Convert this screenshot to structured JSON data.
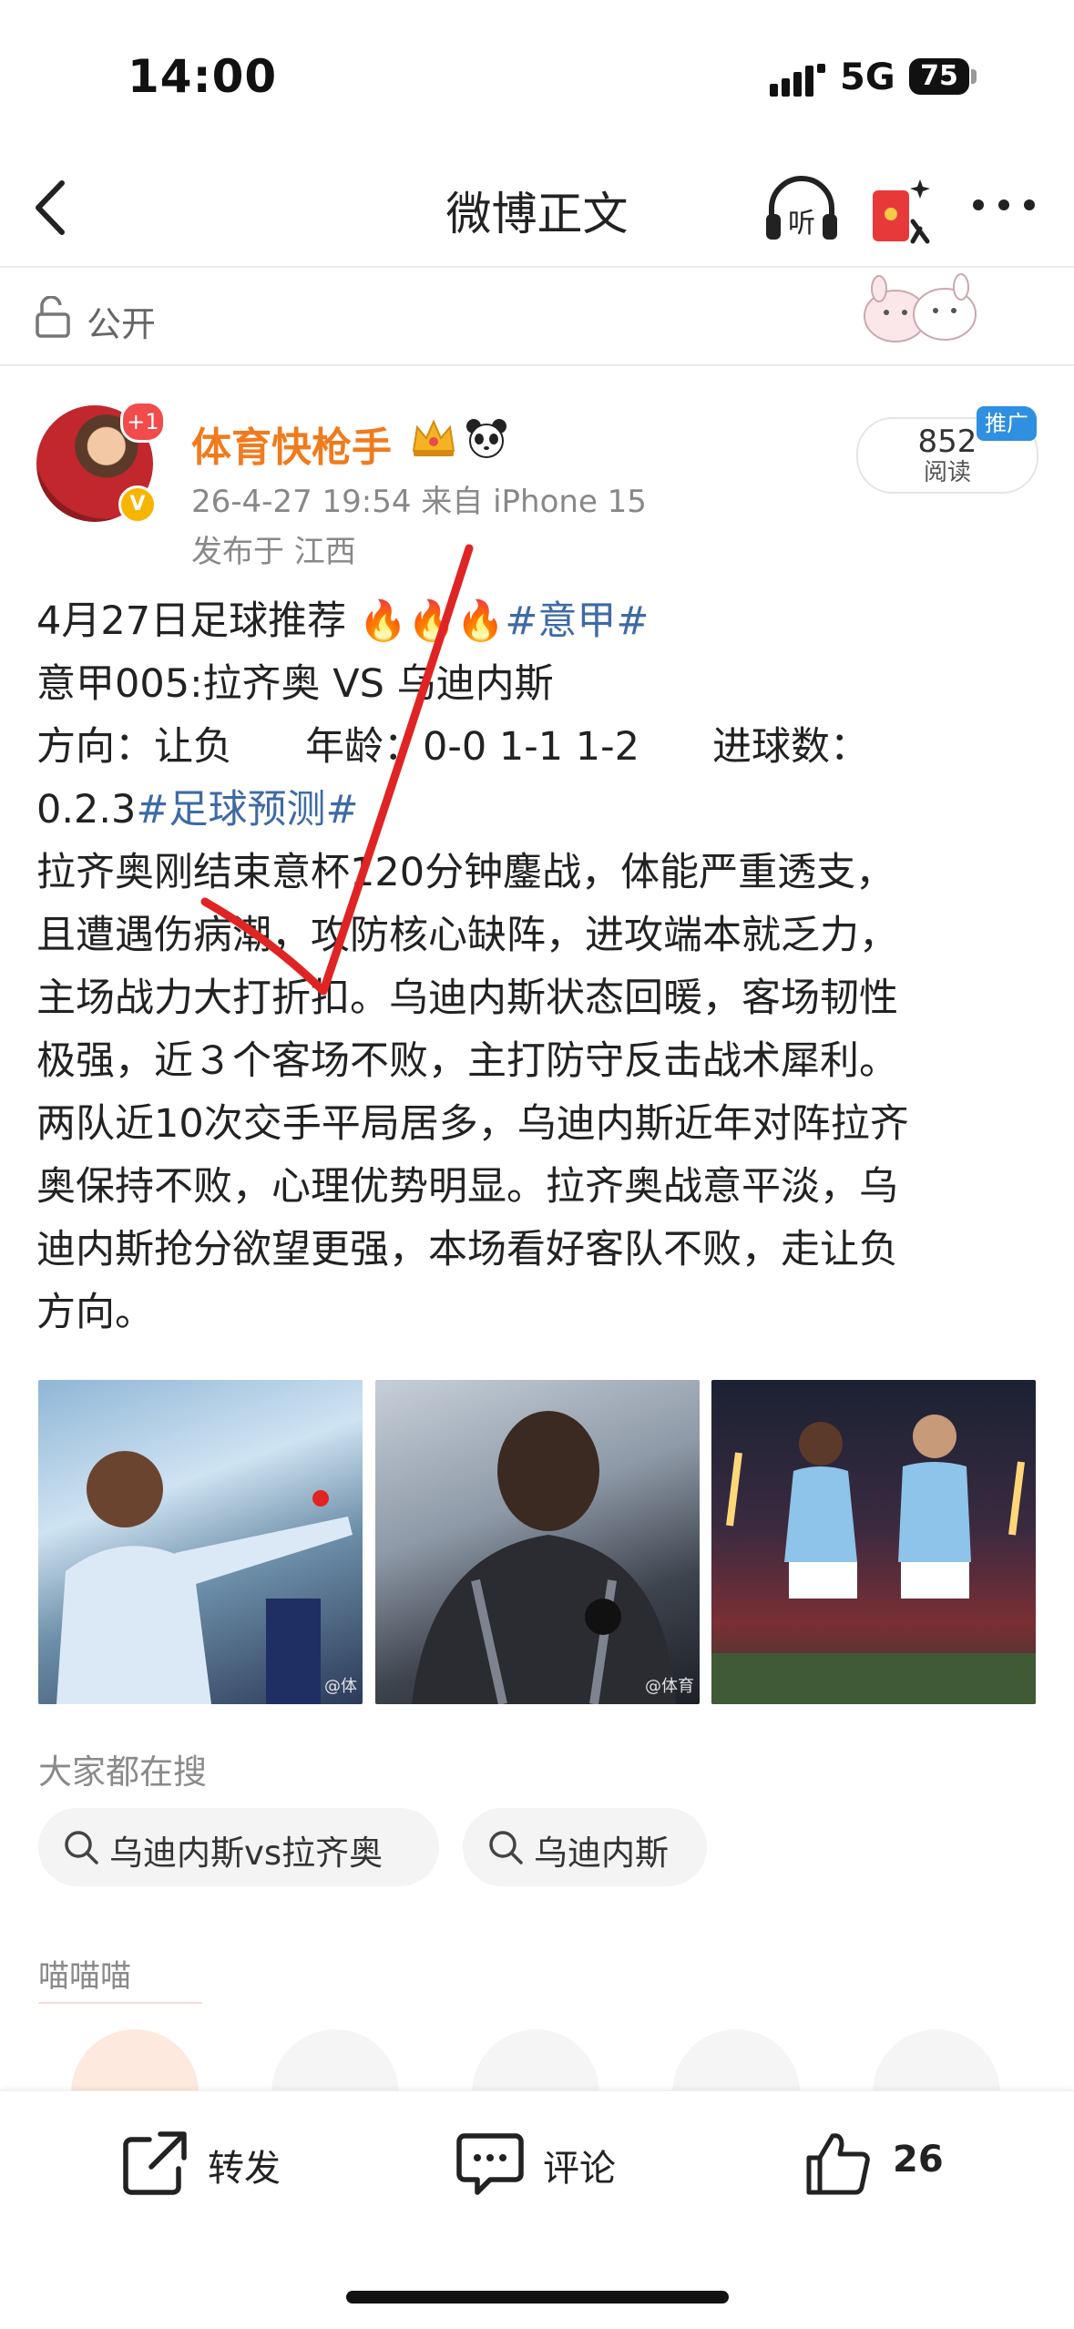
{
  "status_bar": {
    "time": "14:00",
    "network": "5G",
    "battery": "75"
  },
  "nav": {
    "title": "微博正文",
    "back_icon": "chevron-left-icon",
    "listen_icon": "listen-headphones-icon",
    "redpack_icon": "red-envelope-icon",
    "more_icon": "more-dots-icon"
  },
  "visibility": {
    "label": "公开",
    "icon": "lock-open-icon"
  },
  "author": {
    "name": "体育快枪手",
    "avatar_badge": "+1",
    "meta": "26-4-27 19:54  来自 iPhone 15",
    "location": "发布于 江西",
    "reads_count": "852",
    "reads_label": "阅读",
    "promo_tag": "推广"
  },
  "post": {
    "l1_text": "4月27日足球推荐",
    "l1_fire": "🔥🔥🔥",
    "l1_topic": "#意甲#",
    "l2": "意甲005:拉齐奥 VS 乌迪内斯",
    "l3_a": "方向：让负",
    "l3_b": "年龄：0-0  1-1  1-2",
    "l3_c": "进球数：",
    "l4_text": "0.2.3",
    "l4_topic": "#足球预测#",
    "l5": "拉齐奥刚结束意杯120分钟鏖战，体能严重透支，",
    "l6": "且遭遇伤病潮，攻防核心缺阵，进攻端本就乏力，",
    "l7": "主场战力大打折扣。乌迪内斯状态回暖，客场韧性",
    "l8": "极强，近３个客场不败，主打防守反击战术犀利。",
    "l9": "两队近10次交手平局居多，乌迪内斯近年对阵拉齐",
    "l10": "奥保持不败，心理优势明显。拉齐奥战意平淡，乌",
    "l11": "迪内斯抢分欲望更强，本场看好客队不败，走让负",
    "l12": "方向。"
  },
  "photos": [
    {
      "watermark": "@体"
    },
    {
      "watermark": "@体育"
    },
    {
      "watermark": ""
    }
  ],
  "search": {
    "heading": "大家都在搜",
    "chips": [
      "乌迪内斯vs拉齐奥",
      "乌迪内斯"
    ]
  },
  "group": {
    "title": "喵喵喵"
  },
  "toolbar": {
    "repost": "转发",
    "comment": "评论",
    "like_count": "26"
  },
  "colors": {
    "accent_orange": "#f07b1e",
    "topic_blue": "#3e6aa6",
    "promo_blue": "#2f8fe0"
  }
}
